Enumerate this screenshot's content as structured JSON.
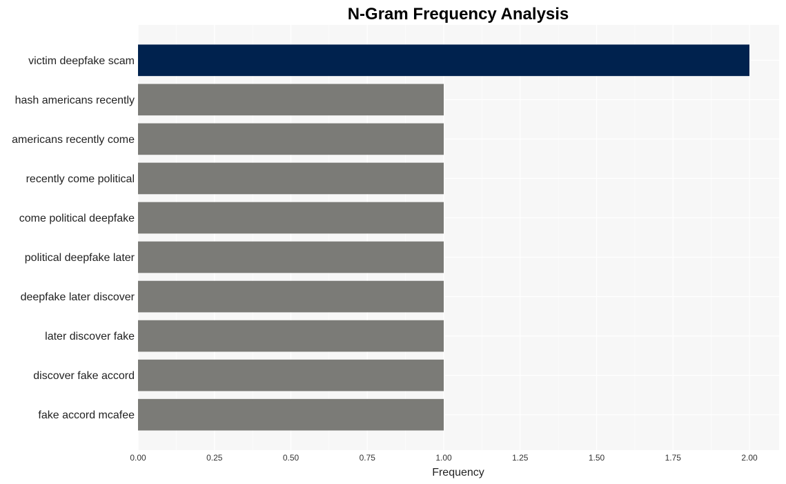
{
  "chart_data": {
    "type": "bar",
    "orientation": "horizontal",
    "title": "N-Gram Frequency Analysis",
    "xlabel": "Frequency",
    "ylabel": "",
    "categories": [
      "victim deepfake scam",
      "hash americans recently",
      "americans recently come",
      "recently come political",
      "come political deepfake",
      "political deepfake later",
      "deepfake later discover",
      "later discover fake",
      "discover fake accord",
      "fake accord mcafee"
    ],
    "values": [
      2,
      1,
      1,
      1,
      1,
      1,
      1,
      1,
      1,
      1
    ],
    "xlim": [
      0,
      2.1
    ],
    "xticks": [
      "0.00",
      "0.25",
      "0.50",
      "0.75",
      "1.00",
      "1.25",
      "1.50",
      "1.75",
      "2.00"
    ],
    "grid": true,
    "colors": {
      "highlight": "#00224e",
      "default": "#7b7b77",
      "panel_background": "#f7f7f7",
      "grid": "#ffffff"
    }
  }
}
